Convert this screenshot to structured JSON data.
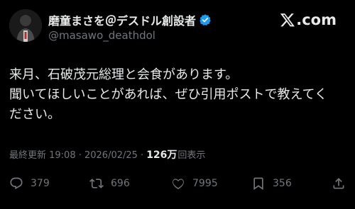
{
  "author": {
    "display_name": "磨童まさを＠デスドル創設者",
    "handle": "@masawo_deathdol",
    "avatar_icon": "profile-photo",
    "verified_icon": "verified-badge-icon",
    "verified_color": "#1d9bf0"
  },
  "brand": {
    "text": ".com",
    "icon": "x-logo-icon"
  },
  "post": {
    "lines": [
      "来月、石破茂元総理と会食があります。",
      "聞いてほしいことがあれば、ぜひ引用ポストで教えてく",
      "ださい。"
    ]
  },
  "meta": {
    "updated_label": "最終更新 19:08 · 2026/02/25 ·",
    "views_count": "126万",
    "views_label": "回表示"
  },
  "actions": {
    "replies": {
      "icon": "reply-icon",
      "count": "379"
    },
    "reposts": {
      "icon": "repost-icon",
      "count": "696"
    },
    "likes": {
      "icon": "like-icon",
      "count": "7995"
    },
    "bookmarks": {
      "icon": "bookmark-icon",
      "count": "356"
    },
    "share": {
      "icon": "share-icon"
    }
  },
  "colors": {
    "background": "#000000",
    "text": "#e7e9ea",
    "muted": "#71767b"
  }
}
